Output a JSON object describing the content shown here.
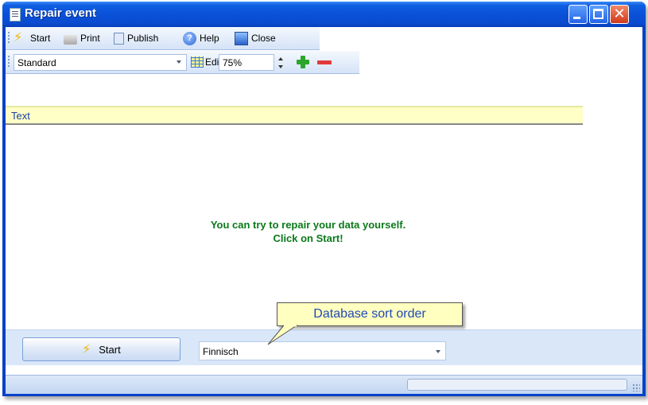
{
  "window": {
    "title": "Repair event"
  },
  "toolbar": {
    "start_label": "Start",
    "print_label": "Print",
    "publish_label": "Publish",
    "help_label": "Help",
    "close_label": "Close",
    "view_select_value": "Standard",
    "edit_label": "Edit",
    "zoom_value": "75%"
  },
  "content": {
    "header_text": "Text",
    "message_line1": "You can try to repair your data yourself.",
    "message_line2": "Click on Start!"
  },
  "footer": {
    "start_button_label": "Start",
    "sort_order_value": "Finnisch",
    "tooltip_text": "Database sort order"
  },
  "colors": {
    "title_bar": "#0a51d8",
    "message_text": "#0a7a1a",
    "header_bg": "#ffffc6",
    "tooltip_bg": "#ffffc0"
  }
}
